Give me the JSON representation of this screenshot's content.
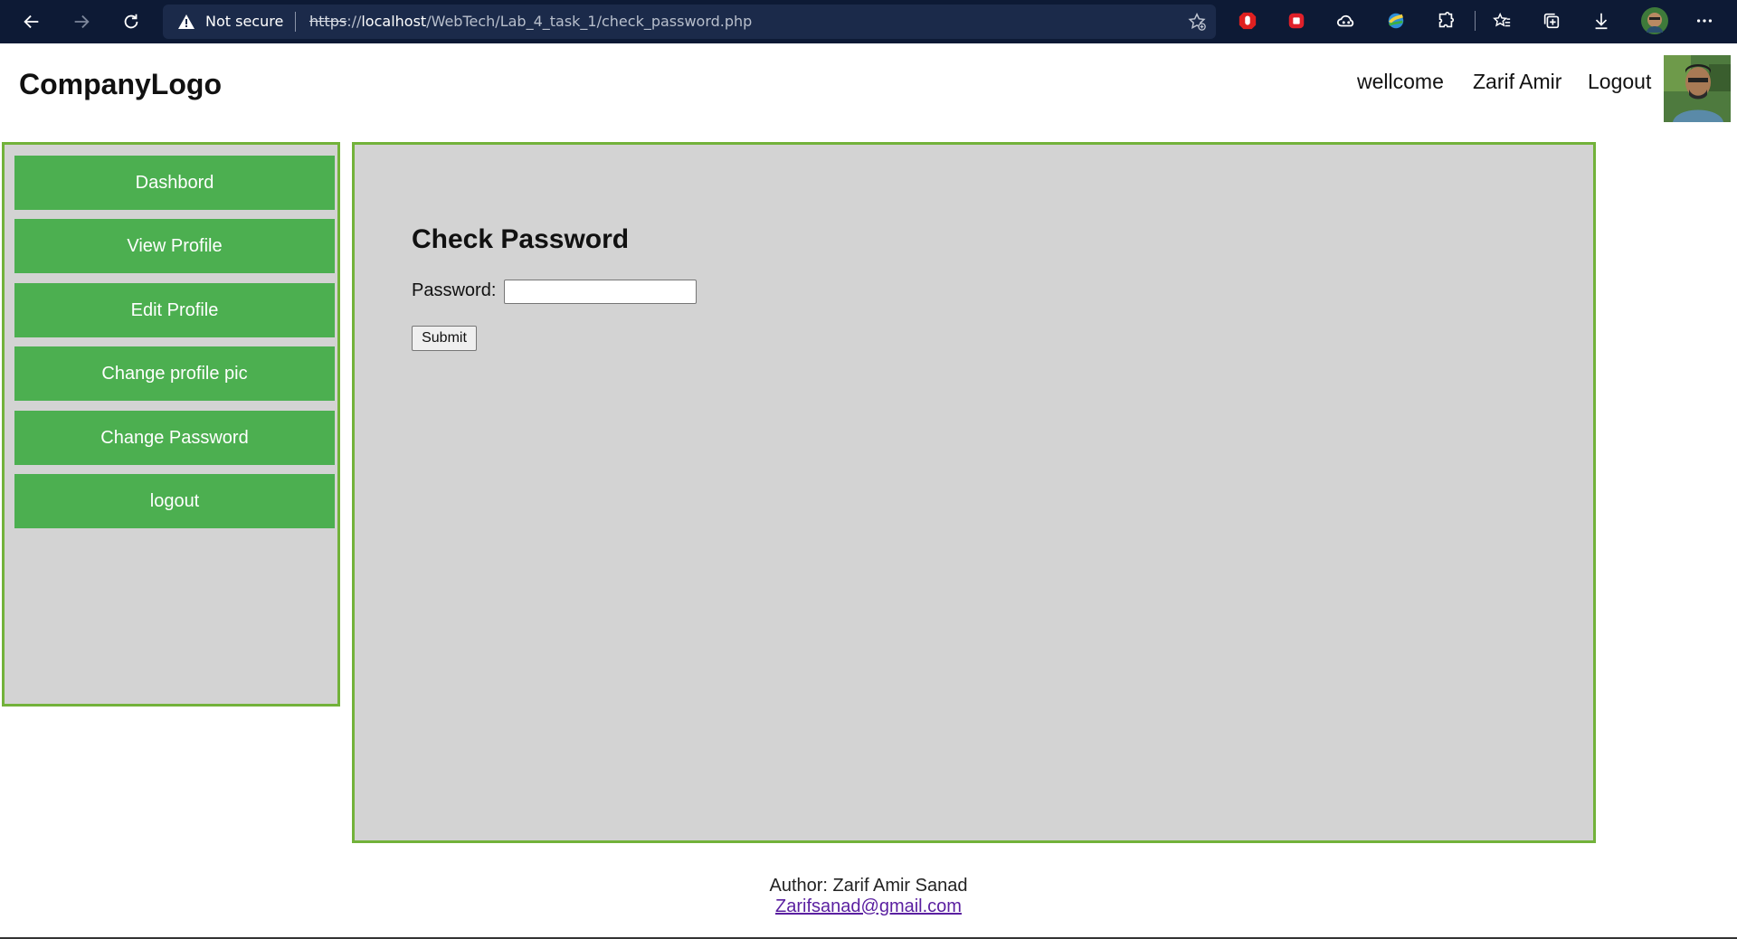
{
  "browser": {
    "security_text": "Not secure",
    "url_scheme": "https",
    "url_sep": "://",
    "url_host": "localhost",
    "url_path": "/WebTech/Lab_4_task_1/check_password.php",
    "icons": [
      "back-icon",
      "forward-icon",
      "reload-icon",
      "warning-icon",
      "add-favorite-icon",
      "extension-red-hand-icon",
      "extension-red-square-icon",
      "extension-cloud-icon",
      "extension-globe-icon",
      "extensions-puzzle-icon",
      "favorites-icon",
      "collections-icon",
      "download-icon",
      "profile-avatar",
      "more-icon"
    ]
  },
  "header": {
    "logo": "CompanyLogo",
    "welcome": "wellcome",
    "user_name": "Zarif Amir",
    "logout": "Logout"
  },
  "sidebar": {
    "items": [
      {
        "label": "Dashbord"
      },
      {
        "label": "View Profile"
      },
      {
        "label": "Edit Profile"
      },
      {
        "label": "Change profile pic"
      },
      {
        "label": "Change Password"
      },
      {
        "label": "logout"
      }
    ]
  },
  "main": {
    "title": "Check Password",
    "password_label": "Password:",
    "password_value": "",
    "submit_label": "Submit"
  },
  "footer": {
    "author": "Author: Zarif Amir Sanad",
    "email": "Zarifsanad@gmail.com"
  },
  "colors": {
    "chrome_bg": "#0d1a35",
    "menu_green": "#4caf50",
    "border_green": "#72b23a",
    "panel_gray": "#d3d3d3"
  }
}
